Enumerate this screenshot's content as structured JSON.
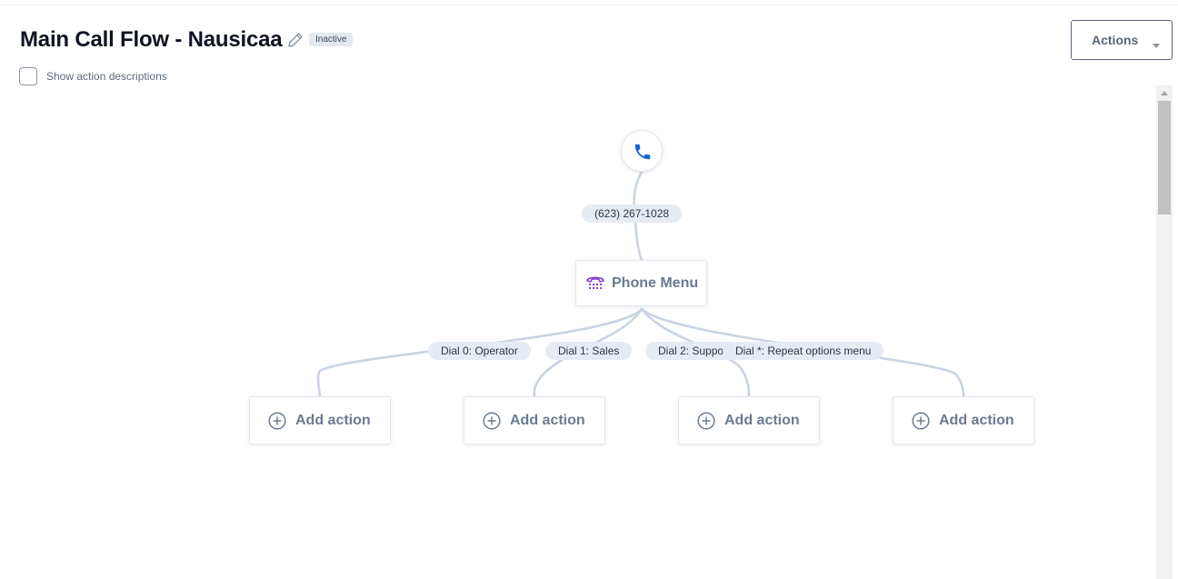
{
  "header": {
    "title": "Main Call Flow - Nausicaa",
    "edit_icon": "pencil-icon",
    "status_badge": "Inactive",
    "show_descriptions_label": "Show action descriptions",
    "show_descriptions_checked": false,
    "actions_label": "Actions",
    "actions_icon": "caret-down-icon"
  },
  "flow": {
    "start_icon": "phone-icon",
    "start_color": "#1565d8",
    "number_label": "(623) 267-1028",
    "menu": {
      "label": "Phone Menu",
      "icon": "phone-menu-icon",
      "icon_color": "#8a3fd1"
    },
    "branches": [
      {
        "label": "Dial 0: Operator",
        "target": "Add action"
      },
      {
        "label": "Dial 1: Sales",
        "target": "Add action"
      },
      {
        "label": "Dial 2: Suppo.",
        "target": "Add action"
      },
      {
        "label": "Dial *: Repeat options menu",
        "target": "Add action"
      }
    ],
    "add_icon": "plus-circle-icon",
    "connector_color": "#c9d3e1"
  },
  "colors": {
    "accent": "#1565d8",
    "badge_bg": "#e3e8f1",
    "node_text": "#6b7a90"
  }
}
